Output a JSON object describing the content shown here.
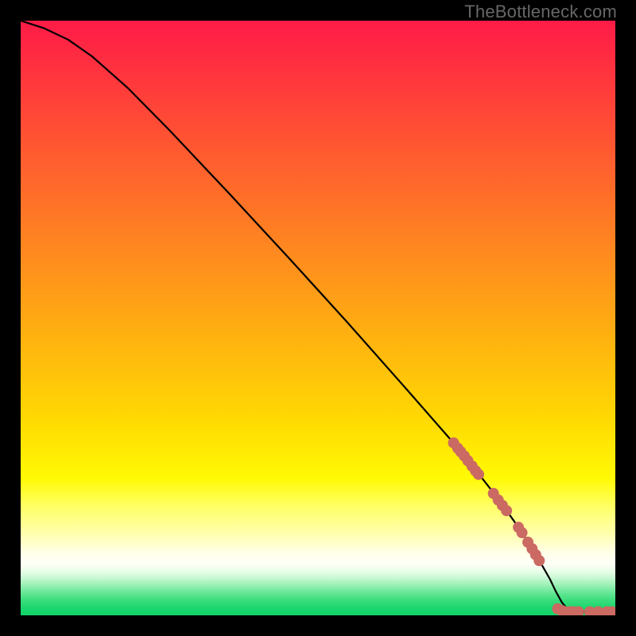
{
  "watermark": "TheBottleneck.com",
  "chart_data": {
    "type": "line",
    "title": "",
    "xlabel": "",
    "ylabel": "",
    "xlim": [
      0,
      100
    ],
    "ylim": [
      0,
      100
    ],
    "curve": [
      {
        "x": 0,
        "y": 100
      },
      {
        "x": 4,
        "y": 98.7
      },
      {
        "x": 8,
        "y": 96.8
      },
      {
        "x": 12,
        "y": 94.0
      },
      {
        "x": 18,
        "y": 88.7
      },
      {
        "x": 25,
        "y": 81.6
      },
      {
        "x": 35,
        "y": 71.0
      },
      {
        "x": 45,
        "y": 60.2
      },
      {
        "x": 55,
        "y": 49.2
      },
      {
        "x": 65,
        "y": 37.9
      },
      {
        "x": 72,
        "y": 29.9
      },
      {
        "x": 77,
        "y": 23.8
      },
      {
        "x": 80,
        "y": 20.0
      },
      {
        "x": 83,
        "y": 15.8
      },
      {
        "x": 85,
        "y": 12.8
      },
      {
        "x": 87,
        "y": 9.6
      },
      {
        "x": 89,
        "y": 6.1
      },
      {
        "x": 90,
        "y": 4.0
      },
      {
        "x": 91,
        "y": 2.2
      },
      {
        "x": 92,
        "y": 1.0
      },
      {
        "x": 93,
        "y": 0.6
      },
      {
        "x": 95,
        "y": 0.6
      },
      {
        "x": 100,
        "y": 0.6
      }
    ],
    "scatter": [
      {
        "x": 72.8,
        "y": 29.0
      },
      {
        "x": 73.5,
        "y": 28.1
      },
      {
        "x": 74.0,
        "y": 27.5
      },
      {
        "x": 74.6,
        "y": 26.8
      },
      {
        "x": 75.2,
        "y": 26.0
      },
      {
        "x": 75.9,
        "y": 25.1
      },
      {
        "x": 76.5,
        "y": 24.3
      },
      {
        "x": 77.0,
        "y": 23.7
      },
      {
        "x": 79.5,
        "y": 20.5
      },
      {
        "x": 80.3,
        "y": 19.4
      },
      {
        "x": 81.0,
        "y": 18.5
      },
      {
        "x": 81.7,
        "y": 17.6
      },
      {
        "x": 83.7,
        "y": 14.8
      },
      {
        "x": 84.3,
        "y": 13.9
      },
      {
        "x": 85.3,
        "y": 12.3
      },
      {
        "x": 86.0,
        "y": 11.2
      },
      {
        "x": 86.6,
        "y": 10.2
      },
      {
        "x": 87.2,
        "y": 9.2
      },
      {
        "x": 90.3,
        "y": 1.1
      },
      {
        "x": 91.0,
        "y": 0.8
      },
      {
        "x": 91.6,
        "y": 0.6
      },
      {
        "x": 92.3,
        "y": 0.6
      },
      {
        "x": 92.9,
        "y": 0.6
      },
      {
        "x": 93.8,
        "y": 0.6
      },
      {
        "x": 95.7,
        "y": 0.6
      },
      {
        "x": 97.1,
        "y": 0.6
      },
      {
        "x": 98.6,
        "y": 0.6
      },
      {
        "x": 99.4,
        "y": 0.6
      }
    ],
    "scatter_color": "#cb6a62",
    "scatter_radius": 7,
    "line_color": "#000000",
    "line_width": 2.2,
    "gradient_bands": [
      {
        "top": 0.0,
        "height": 67.0,
        "from": "#ff1b47",
        "to": "#ffd902"
      },
      {
        "top": 67.0,
        "height": 10.0,
        "from": "#ffd902",
        "to": "#fffa05"
      },
      {
        "top": 77.0,
        "height": 4.5,
        "from": "#fffa05",
        "to": "#ffff63"
      },
      {
        "top": 81.5,
        "height": 4.8,
        "from": "#ffff63",
        "to": "#ffffb0"
      },
      {
        "top": 86.3,
        "height": 3.1,
        "from": "#ffffb0",
        "to": "#ffffe8"
      },
      {
        "top": 89.4,
        "height": 1.9,
        "from": "#ffffe8",
        "to": "#fefff6"
      },
      {
        "top": 91.3,
        "height": 1.35,
        "from": "#fefff6",
        "to": "#e7fde7"
      },
      {
        "top": 92.65,
        "height": 1.25,
        "from": "#e7fde7",
        "to": "#c1f7ce"
      },
      {
        "top": 93.9,
        "height": 1.2,
        "from": "#c1f7ce",
        "to": "#92efb0"
      },
      {
        "top": 95.1,
        "height": 1.2,
        "from": "#92efb0",
        "to": "#62e693"
      },
      {
        "top": 96.3,
        "height": 1.2,
        "from": "#62e693",
        "to": "#39dd7c"
      },
      {
        "top": 97.5,
        "height": 1.3,
        "from": "#39dd7c",
        "to": "#1bd66d"
      },
      {
        "top": 98.8,
        "height": 1.2,
        "from": "#1bd66d",
        "to": "#10d467"
      }
    ]
  }
}
